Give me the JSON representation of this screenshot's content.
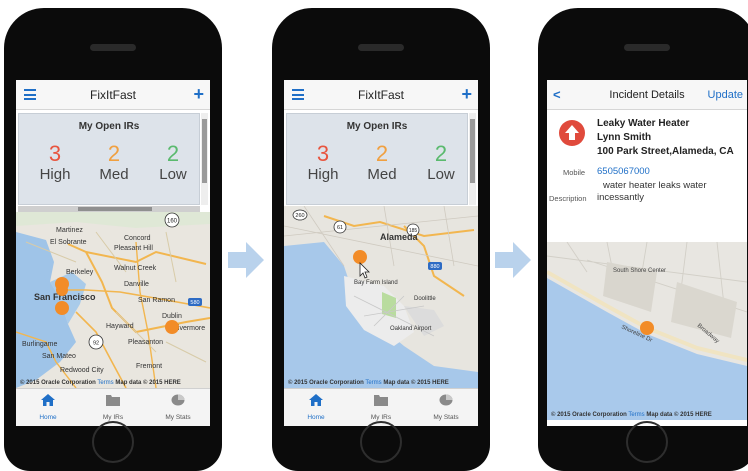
{
  "colors": {
    "high": "#e8553f",
    "med": "#f0a040",
    "low": "#5aba6e",
    "accent": "#1f6fc7",
    "marker": "#f28c28",
    "alert": "#e04a3c",
    "arrow": "#b9d2ec"
  },
  "app": {
    "title": "FixItFast",
    "menu_icon": "hamburger-menu-icon",
    "add_icon": "plus-icon"
  },
  "summary": {
    "title": "My Open IRs",
    "stats": [
      {
        "count": "3",
        "label": "High"
      },
      {
        "count": "2",
        "label": "Med"
      },
      {
        "count": "2",
        "label": "Low"
      }
    ]
  },
  "tabs": [
    {
      "label": "Home",
      "icon": "home-icon"
    },
    {
      "label": "My IRs",
      "icon": "folder-icon"
    },
    {
      "label": "My Stats",
      "icon": "stats-icon"
    }
  ],
  "maps": {
    "bay_area": {
      "labels": [
        "El Sobrante",
        "Martinez",
        "Concord",
        "Pleasant Hill",
        "Berkeley",
        "Walnut Creek",
        "San Francisco",
        "Danville",
        "San Ramon",
        "Hayward",
        "Dublin",
        "Livermore",
        "Pleasanton",
        "Fremont",
        "Burlingame",
        "San Mateo",
        "Redwood City"
      ],
      "attribution": "© 2015 Oracle Corporation",
      "terms": "Terms",
      "map_data": "Map data © 2015 HERE"
    },
    "alameda": {
      "labels": [
        "Alameda",
        "Oakland Airport",
        "Bay Farm Island",
        "Doolittle"
      ],
      "attribution": "© 2015 Oracle Corporation",
      "terms": "Terms",
      "map_data": "Map data © 2015 HERE"
    },
    "detail": {
      "labels": [
        "South Shore Center",
        "Shoreline Dr",
        "Broadway"
      ],
      "attribution": "© 2015 Oracle Corporation",
      "terms": "Terms",
      "map_data": "Map data © 2015 HERE"
    }
  },
  "incident": {
    "header_title": "Incident Details",
    "back_icon": "chevron-left-icon",
    "update_label": "Update",
    "alert_icon": "arrow-up-alert-icon",
    "title": "Leaky Water Heater",
    "customer": "Lynn Smith",
    "address": "100 Park Street,Alameda, CA",
    "mobile_label": "Mobile",
    "mobile": "6505067000",
    "description_label": "Description",
    "description_line1": "water heater leaks water",
    "description_line2": "incessantly"
  }
}
